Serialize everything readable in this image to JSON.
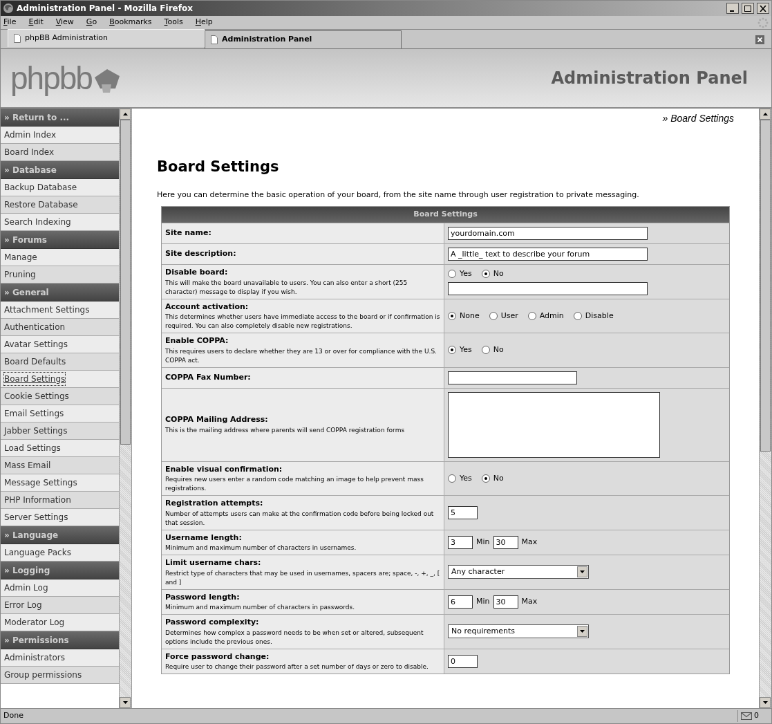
{
  "window": {
    "title": "Administration Panel - Mozilla Firefox"
  },
  "menu": [
    "File",
    "Edit",
    "View",
    "Go",
    "Bookmarks",
    "Tools",
    "Help"
  ],
  "tabs": [
    {
      "label": "phpBB Administration",
      "selected": false
    },
    {
      "label": "Administration Panel",
      "selected": true
    }
  ],
  "header": {
    "logo": "phpbb",
    "title": "Administration Panel"
  },
  "sidebar": {
    "sections": [
      {
        "title": "» Return to ...",
        "items": [
          {
            "label": "Admin Index",
            "selected": false
          },
          {
            "label": "Board Index",
            "selected": false
          }
        ]
      },
      {
        "title": "» Database",
        "items": [
          {
            "label": "Backup Database",
            "selected": false
          },
          {
            "label": "Restore Database",
            "selected": false
          },
          {
            "label": "Search Indexing",
            "selected": false
          }
        ]
      },
      {
        "title": "» Forums",
        "items": [
          {
            "label": "Manage",
            "selected": false
          },
          {
            "label": "Pruning",
            "selected": false
          }
        ]
      },
      {
        "title": "» General",
        "items": [
          {
            "label": "Attachment Settings",
            "selected": false
          },
          {
            "label": "Authentication",
            "selected": false
          },
          {
            "label": "Avatar Settings",
            "selected": false
          },
          {
            "label": "Board Defaults",
            "selected": false
          },
          {
            "label": "Board Settings",
            "selected": true
          },
          {
            "label": "Cookie Settings",
            "selected": false
          },
          {
            "label": "Email Settings",
            "selected": false
          },
          {
            "label": "Jabber Settings",
            "selected": false
          },
          {
            "label": "Load Settings",
            "selected": false
          },
          {
            "label": "Mass Email",
            "selected": false
          },
          {
            "label": "Message Settings",
            "selected": false
          },
          {
            "label": "PHP Information",
            "selected": false
          },
          {
            "label": "Server Settings",
            "selected": false
          }
        ]
      },
      {
        "title": "» Language",
        "items": [
          {
            "label": "Language Packs",
            "selected": false
          }
        ]
      },
      {
        "title": "» Logging",
        "items": [
          {
            "label": "Admin Log",
            "selected": false
          },
          {
            "label": "Error Log",
            "selected": false
          },
          {
            "label": "Moderator Log",
            "selected": false
          }
        ]
      },
      {
        "title": "» Permissions",
        "items": [
          {
            "label": "Administrators",
            "selected": false
          },
          {
            "label": "Group permissions",
            "selected": false
          }
        ]
      }
    ]
  },
  "breadcrumb": "» Board Settings",
  "page": {
    "title": "Board Settings",
    "intro": "Here you can determine the basic operation of your board, from the site name through user registration to private messaging."
  },
  "table": {
    "heading": "Board Settings",
    "rows": [
      {
        "label": "Site name:",
        "kind": "text",
        "value": "yourdomain.com"
      },
      {
        "label": "Site description:",
        "kind": "text",
        "value": "A _little_ text to describe your forum"
      },
      {
        "label": "Disable board:",
        "description": "This will make the board unavailable to users. You can also enter a short (255 character) message to display if you wish.",
        "kind": "radio_text",
        "options": [
          {
            "label": "Yes",
            "selected": false
          },
          {
            "label": "No",
            "selected": true
          }
        ]
      },
      {
        "label": "Account activation:",
        "description": "This determines whether users have immediate access to the board or if confirmation is required. You can also completely disable new registrations.",
        "kind": "radio",
        "options": [
          {
            "label": "None",
            "selected": true
          },
          {
            "label": "User",
            "selected": false
          },
          {
            "label": "Admin",
            "selected": false
          },
          {
            "label": "Disable",
            "selected": false
          }
        ]
      },
      {
        "label": "Enable COPPA:",
        "description": "This requires users to declare whether they are 13 or over for compliance with the U.S. COPPA act.",
        "kind": "radio",
        "options": [
          {
            "label": "Yes",
            "selected": true
          },
          {
            "label": "No",
            "selected": false
          }
        ]
      },
      {
        "label": "COPPA Fax Number:",
        "kind": "short_text"
      },
      {
        "label": "COPPA Mailing Address:",
        "description": "This is the mailing address where parents will send COPPA registration forms",
        "kind": "textarea"
      },
      {
        "label": "Enable visual confirmation:",
        "description": "Requires new users enter a random code matching an image to help prevent mass registrations.",
        "kind": "radio",
        "options": [
          {
            "label": "Yes",
            "selected": false
          },
          {
            "label": "No",
            "selected": true
          }
        ]
      },
      {
        "label": "Registration attempts:",
        "description": "Number of attempts users can make at the confirmation code before being locked out that session.",
        "kind": "number",
        "value": "5"
      },
      {
        "label": "Username length:",
        "description": "Minimum and maximum number of characters in usernames.",
        "kind": "range",
        "min": "3",
        "min_label": "Min",
        "max": "30",
        "max_label": "Max"
      },
      {
        "label": "Limit username chars:",
        "description": "Restrict type of characters that may be used in usernames, spacers are; space, -, +, _, [ and ]",
        "kind": "select",
        "value": "Any character"
      },
      {
        "label": "Password length:",
        "description": "Minimum and maximum number of characters in passwords.",
        "kind": "range",
        "min": "6",
        "min_label": "Min",
        "max": "30",
        "max_label": "Max"
      },
      {
        "label": "Password complexity:",
        "description": "Determines how complex a password needs to be when set or altered, subsequent options include the previous ones.",
        "kind": "select",
        "value": "No requirements"
      },
      {
        "label": "Force password change:",
        "description": "Require user to change their password after a set number of days or zero to disable.",
        "kind": "number",
        "value": "0"
      }
    ]
  },
  "status_bar": {
    "text": "Done",
    "mail_count": "0"
  }
}
